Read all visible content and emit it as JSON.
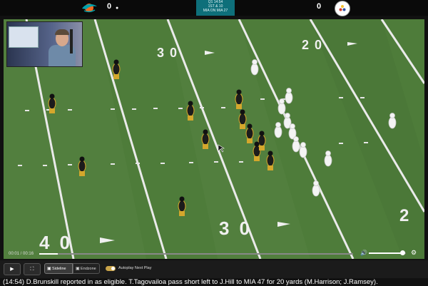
{
  "scoreboard": {
    "home_score": "0",
    "away_score": "0",
    "clock": "Q1 14:54",
    "down_distance": "1ST & 10",
    "field_position": "MIA ON MIA 27",
    "possession_marker": "●"
  },
  "field": {
    "yard_numbers": [
      "30",
      "30",
      "20",
      "40",
      "30",
      "2"
    ]
  },
  "player": {
    "time_current": "00:01",
    "time_total": "00:16",
    "time_separator": " / ",
    "progress": 0.06,
    "volume": 0.9
  },
  "controls": {
    "play_icon": "▶",
    "fullscreen_icon": "⛶",
    "camera_tabs": [
      "Sideline",
      "Endzone"
    ],
    "autoplay_label": "Autoplay Next Play",
    "autoplay_on": true
  },
  "play_description": "(14:54) D.Brunskill reported in as eligible. T.Tagovailoa pass short left to J.Hill to MIA 47 for 20 yards (M.Harrison; J.Ramsey).",
  "colors": {
    "field": "#4f7d3c",
    "clock_box": "#0e6f7a",
    "steelers_jersey": "#1c1c1c",
    "steelers_gold": "#d4a72c",
    "dolphins_white": "#f4f4f4",
    "autoplay_toggle": "#c9a449"
  },
  "icons": [
    "dolphins-logo-icon",
    "steelers-logo-icon",
    "play-icon",
    "fullscreen-icon",
    "video-camera-icon",
    "volume-icon",
    "settings-gear-icon"
  ]
}
